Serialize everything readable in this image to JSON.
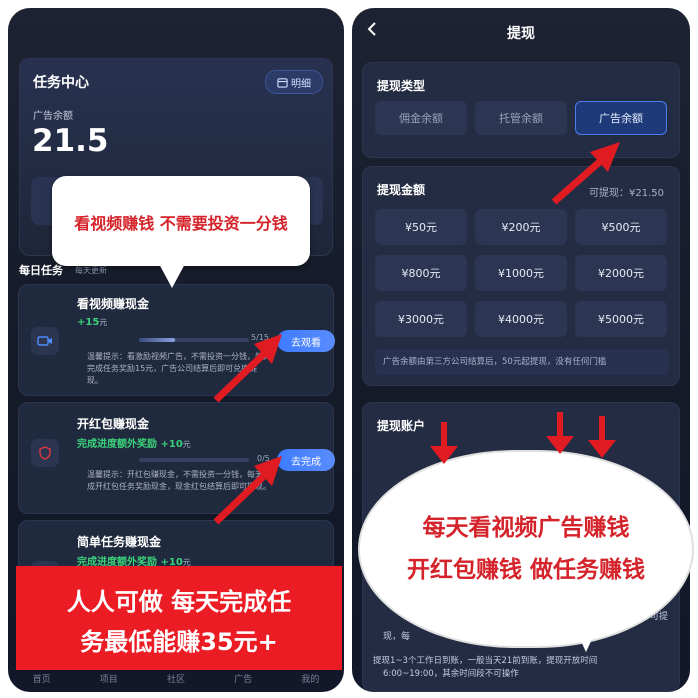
{
  "left": {
    "header": {
      "title": "任务中心",
      "detail_label": "明细",
      "balance_label": "广告余额",
      "balance_value": "21.5"
    },
    "daily": {
      "title": "每日任务",
      "subtitle": "每天更新"
    },
    "tasks": [
      {
        "title": "看视频赚现金",
        "reward": "+15",
        "reward_unit": "元",
        "progress_text": "5/15",
        "progress": 0.33,
        "button": "去观看",
        "tip": "温馨提示：看激励视频广告，不需投资一分钱，每天完成任务奖励15元，广告公司结算后即可兑换提现。"
      },
      {
        "title": "开红包赚现金",
        "reward": "完成进度额外奖励 +10",
        "reward_unit": "元",
        "progress_text": "0/5",
        "progress": 0.0,
        "button": "去完成",
        "tip": "温馨提示：开红包赚现金，不需投资一分钱，每天完成开红包任务奖励现金，现金红包结算后即可提现。"
      },
      {
        "title": "简单任务赚现金",
        "reward": "完成进度额外奖励 +10",
        "reward_unit": "元"
      }
    ],
    "nav": [
      "首页",
      "项目",
      "社区",
      "广告",
      "我的"
    ],
    "bubble_text": "看视频赚钱 不需要投资一分钱",
    "banner": {
      "line1": "人人可做 每天完成任",
      "line2": "务最低能赚35元+"
    }
  },
  "right": {
    "title": "提现",
    "type_section": {
      "label": "提现类型",
      "options": [
        "佣金余额",
        "托管余额",
        "广告余额"
      ],
      "selected": 2
    },
    "amount_section": {
      "label": "提现金额",
      "available": "可提现：¥21.50",
      "amounts": [
        "¥50元",
        "¥200元",
        "¥500元",
        "¥800元",
        "¥1000元",
        "¥2000元",
        "¥3000元",
        "¥4000元",
        "¥5000元"
      ],
      "note": "广告余额由第三方公司结算后，50元起提现，没有任何门槛"
    },
    "account_section": {
      "label": "提现账户"
    },
    "notes": {
      "partial1": "即可提",
      "partial2": "现，每",
      "line1": "提现1~3个工作日到账，一般当天21前到账，提现开放时间",
      "line2": "6:00~19:00，其余时间段不可操作"
    },
    "cloud": {
      "line1": "每天看视频广告赚钱",
      "line2": "开红包赚钱 做任务赚钱"
    }
  },
  "colors": {
    "accent": "#4c7cf0",
    "reward_green": "#3ad17a",
    "overlay_red": "#ec1c24"
  }
}
